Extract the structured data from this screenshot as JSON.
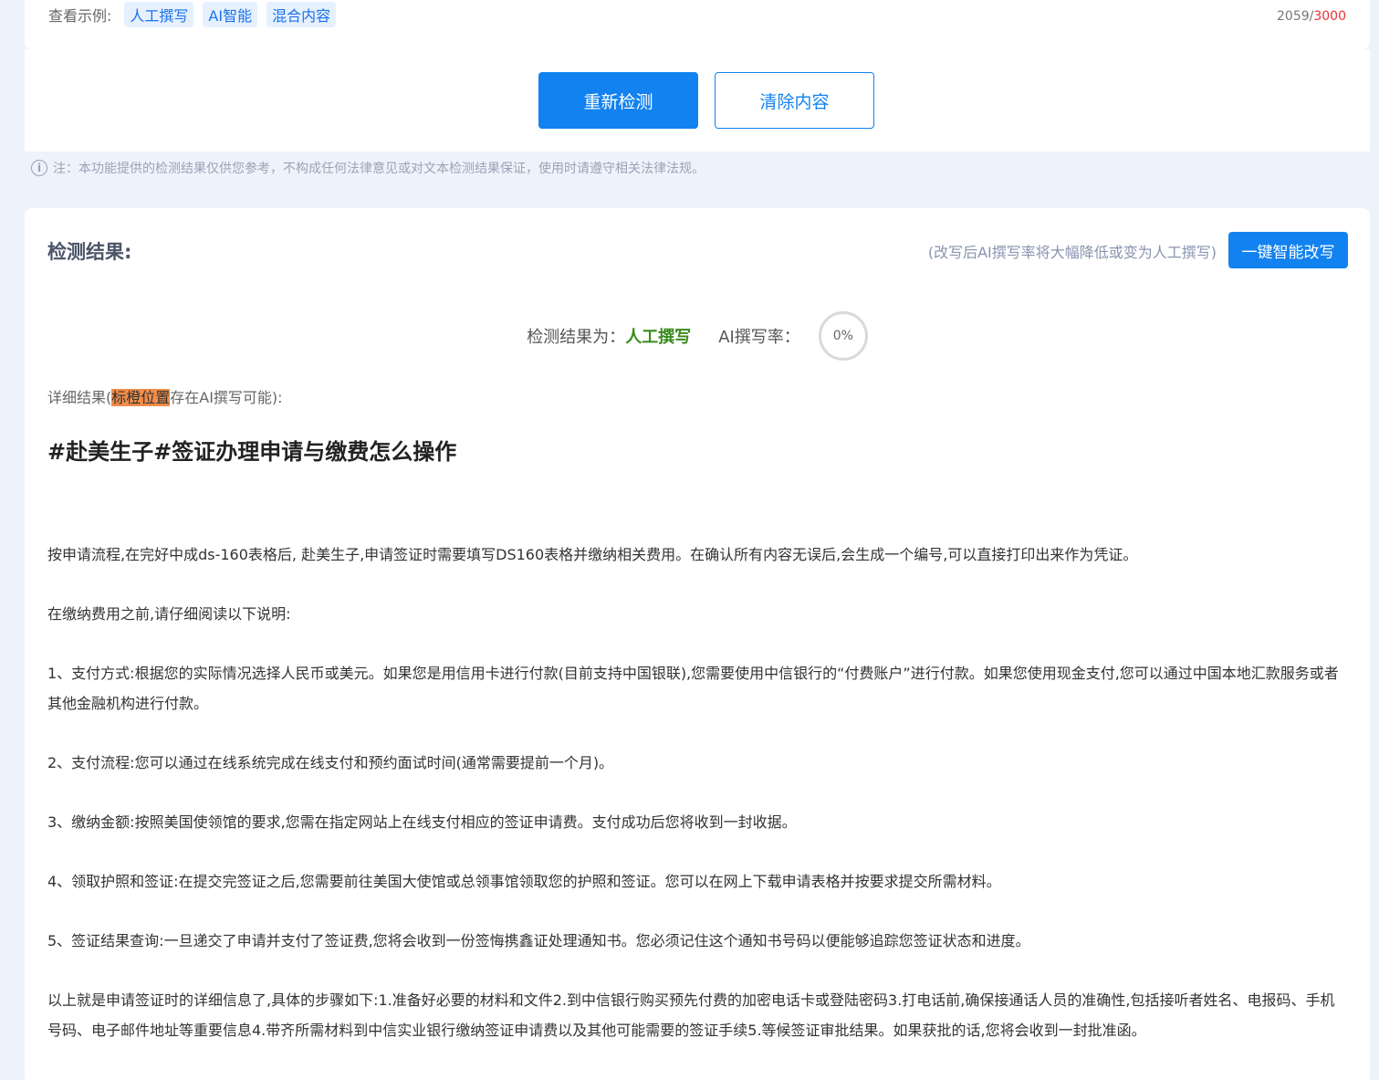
{
  "top": {
    "examples_label": "查看示例:",
    "tags": [
      "人工撰写",
      "AI智能",
      "混合内容"
    ],
    "count_current": "2059/",
    "count_max": "3000"
  },
  "actions": {
    "recheck_label": "重新检测",
    "clear_label": "清除内容"
  },
  "note": {
    "icon": "info-icon",
    "text": "注：本功能提供的检测结果仅供您参考，不构成任何法律意见或对文本检测结果保证，使用时请遵守相关法律法规。"
  },
  "result": {
    "title": "检测结果:",
    "rewrite_hint": "(改写后AI撰写率将大幅降低或变为人工撰写)",
    "rewrite_button": "一键智能改写",
    "summary_label": "检测结果为：",
    "verdict": "人工撰写",
    "rate_label": "AI撰写率：",
    "rate_value": "0%",
    "detail_prefix": "详细结果(",
    "detail_highlight": "标橙位置",
    "detail_suffix": "存在AI撰写可能):",
    "article_title": "#赴美生子#签证办理申请与缴费怎么操作",
    "paragraphs": [
      "按申请流程,在完好中成ds-160表格后, 赴美生子,申请签证时需要填写DS160表格并缴纳相关费用。在确认所有内容无误后,会生成一个编号,可以直接打印出来作为凭证。",
      "在缴纳费用之前,请仔细阅读以下说明:",
      "1、支付方式:根据您的实际情况选择人民币或美元。如果您是用信用卡进行付款(目前支持中国银联),您需要使用中信银行的“付费账户”进行付款。如果您使用现金支付,您可以通过中国本地汇款服务或者其他金融机构进行付款。",
      "2、支付流程:您可以通过在线系统完成在线支付和预约面试时间(通常需要提前一个月)。",
      "3、缴纳金额:按照美国使领馆的要求,您需在指定网站上在线支付相应的签证申请费。支付成功后您将收到一封收据。",
      "4、领取护照和签证:在提交完签证之后,您需要前往美国大使馆或总领事馆领取您的护照和签证。您可以在网上下载申请表格并按要求提交所需材料。",
      "5、签证结果查询:一旦递交了申请并支付了签证费,您将会收到一份签悔携鑫证处理通知书。您必须记住这个通知书号码以便能够追踪您签证状态和进度。",
      "以上就是申请签证时的详细信息了,具体的步骤如下:1.准备好必要的材料和文件2.到中信银行购买预先付费的加密电话卡或登陆密码3.打电话前,确保接通话人员的准确性,包括接听者姓名、电报码、手机号码、电子邮件地址等重要信息4.带齐所需材料到中信实业银行缴纳签证申请费以及其他可能需要的签证手续5.等候签证审批结果。如果获批的话,您将会收到一封批准函。"
    ]
  }
}
